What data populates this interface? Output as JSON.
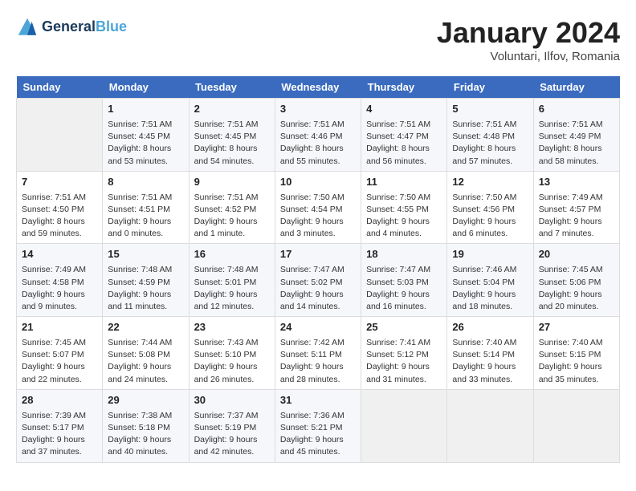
{
  "logo": {
    "line1": "General",
    "line2": "Blue"
  },
  "title": "January 2024",
  "location": "Voluntari, Ilfov, Romania",
  "days_of_week": [
    "Sunday",
    "Monday",
    "Tuesday",
    "Wednesday",
    "Thursday",
    "Friday",
    "Saturday"
  ],
  "weeks": [
    [
      {
        "num": "",
        "info": ""
      },
      {
        "num": "1",
        "info": "Sunrise: 7:51 AM\nSunset: 4:45 PM\nDaylight: 8 hours\nand 53 minutes."
      },
      {
        "num": "2",
        "info": "Sunrise: 7:51 AM\nSunset: 4:45 PM\nDaylight: 8 hours\nand 54 minutes."
      },
      {
        "num": "3",
        "info": "Sunrise: 7:51 AM\nSunset: 4:46 PM\nDaylight: 8 hours\nand 55 minutes."
      },
      {
        "num": "4",
        "info": "Sunrise: 7:51 AM\nSunset: 4:47 PM\nDaylight: 8 hours\nand 56 minutes."
      },
      {
        "num": "5",
        "info": "Sunrise: 7:51 AM\nSunset: 4:48 PM\nDaylight: 8 hours\nand 57 minutes."
      },
      {
        "num": "6",
        "info": "Sunrise: 7:51 AM\nSunset: 4:49 PM\nDaylight: 8 hours\nand 58 minutes."
      }
    ],
    [
      {
        "num": "7",
        "info": "Sunrise: 7:51 AM\nSunset: 4:50 PM\nDaylight: 8 hours\nand 59 minutes."
      },
      {
        "num": "8",
        "info": "Sunrise: 7:51 AM\nSunset: 4:51 PM\nDaylight: 9 hours\nand 0 minutes."
      },
      {
        "num": "9",
        "info": "Sunrise: 7:51 AM\nSunset: 4:52 PM\nDaylight: 9 hours\nand 1 minute."
      },
      {
        "num": "10",
        "info": "Sunrise: 7:50 AM\nSunset: 4:54 PM\nDaylight: 9 hours\nand 3 minutes."
      },
      {
        "num": "11",
        "info": "Sunrise: 7:50 AM\nSunset: 4:55 PM\nDaylight: 9 hours\nand 4 minutes."
      },
      {
        "num": "12",
        "info": "Sunrise: 7:50 AM\nSunset: 4:56 PM\nDaylight: 9 hours\nand 6 minutes."
      },
      {
        "num": "13",
        "info": "Sunrise: 7:49 AM\nSunset: 4:57 PM\nDaylight: 9 hours\nand 7 minutes."
      }
    ],
    [
      {
        "num": "14",
        "info": "Sunrise: 7:49 AM\nSunset: 4:58 PM\nDaylight: 9 hours\nand 9 minutes."
      },
      {
        "num": "15",
        "info": "Sunrise: 7:48 AM\nSunset: 4:59 PM\nDaylight: 9 hours\nand 11 minutes."
      },
      {
        "num": "16",
        "info": "Sunrise: 7:48 AM\nSunset: 5:01 PM\nDaylight: 9 hours\nand 12 minutes."
      },
      {
        "num": "17",
        "info": "Sunrise: 7:47 AM\nSunset: 5:02 PM\nDaylight: 9 hours\nand 14 minutes."
      },
      {
        "num": "18",
        "info": "Sunrise: 7:47 AM\nSunset: 5:03 PM\nDaylight: 9 hours\nand 16 minutes."
      },
      {
        "num": "19",
        "info": "Sunrise: 7:46 AM\nSunset: 5:04 PM\nDaylight: 9 hours\nand 18 minutes."
      },
      {
        "num": "20",
        "info": "Sunrise: 7:45 AM\nSunset: 5:06 PM\nDaylight: 9 hours\nand 20 minutes."
      }
    ],
    [
      {
        "num": "21",
        "info": "Sunrise: 7:45 AM\nSunset: 5:07 PM\nDaylight: 9 hours\nand 22 minutes."
      },
      {
        "num": "22",
        "info": "Sunrise: 7:44 AM\nSunset: 5:08 PM\nDaylight: 9 hours\nand 24 minutes."
      },
      {
        "num": "23",
        "info": "Sunrise: 7:43 AM\nSunset: 5:10 PM\nDaylight: 9 hours\nand 26 minutes."
      },
      {
        "num": "24",
        "info": "Sunrise: 7:42 AM\nSunset: 5:11 PM\nDaylight: 9 hours\nand 28 minutes."
      },
      {
        "num": "25",
        "info": "Sunrise: 7:41 AM\nSunset: 5:12 PM\nDaylight: 9 hours\nand 31 minutes."
      },
      {
        "num": "26",
        "info": "Sunrise: 7:40 AM\nSunset: 5:14 PM\nDaylight: 9 hours\nand 33 minutes."
      },
      {
        "num": "27",
        "info": "Sunrise: 7:40 AM\nSunset: 5:15 PM\nDaylight: 9 hours\nand 35 minutes."
      }
    ],
    [
      {
        "num": "28",
        "info": "Sunrise: 7:39 AM\nSunset: 5:17 PM\nDaylight: 9 hours\nand 37 minutes."
      },
      {
        "num": "29",
        "info": "Sunrise: 7:38 AM\nSunset: 5:18 PM\nDaylight: 9 hours\nand 40 minutes."
      },
      {
        "num": "30",
        "info": "Sunrise: 7:37 AM\nSunset: 5:19 PM\nDaylight: 9 hours\nand 42 minutes."
      },
      {
        "num": "31",
        "info": "Sunrise: 7:36 AM\nSunset: 5:21 PM\nDaylight: 9 hours\nand 45 minutes."
      },
      {
        "num": "",
        "info": ""
      },
      {
        "num": "",
        "info": ""
      },
      {
        "num": "",
        "info": ""
      }
    ]
  ]
}
